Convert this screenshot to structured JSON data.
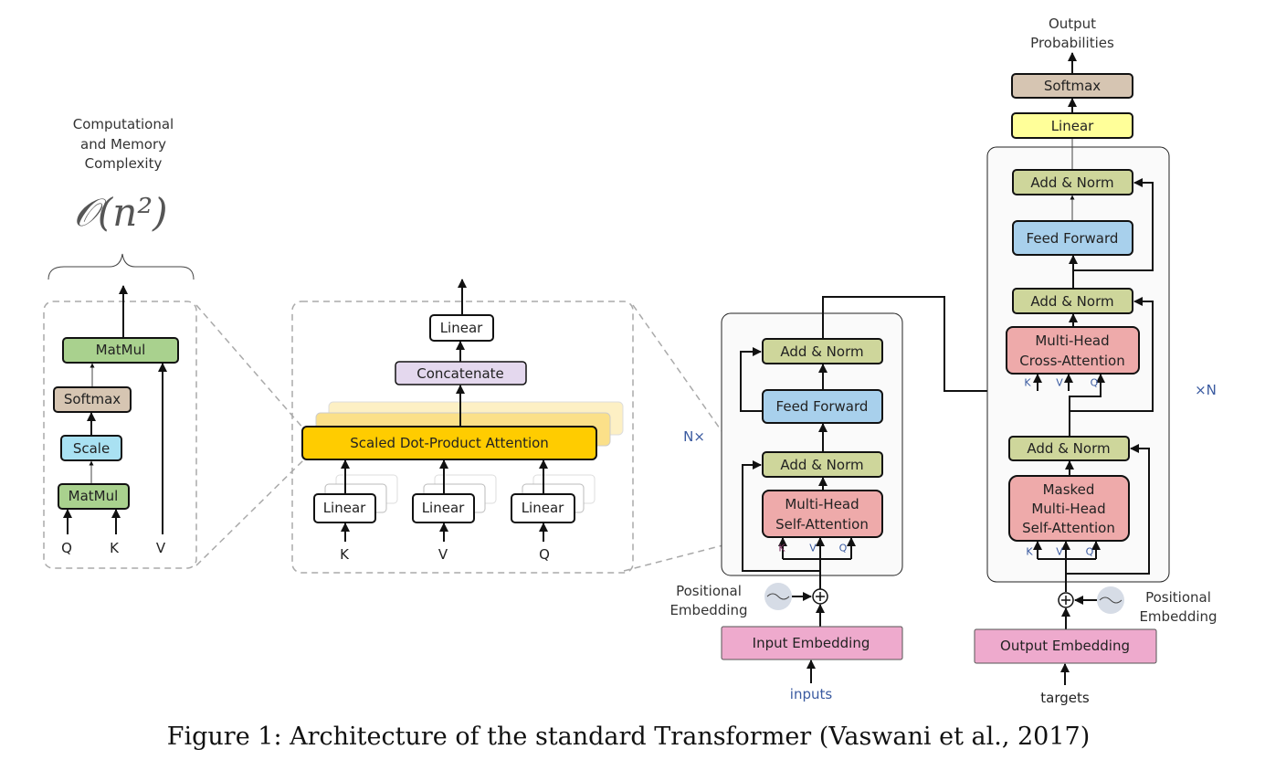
{
  "complexity": {
    "title_lines": [
      "Computational",
      "and Memory",
      "Complexity"
    ],
    "formula": "𝒪(n²)"
  },
  "attention_detail": {
    "matmul_top": "MatMul",
    "softmax": "Softmax",
    "scale": "Scale",
    "matmul_bottom": "MatMul",
    "inputs": [
      "Q",
      "K",
      "V"
    ]
  },
  "multihead_detail": {
    "linear_out": "Linear",
    "concatenate": "Concatenate",
    "sdpa": "Scaled Dot-Product Attention",
    "linears": [
      "Linear",
      "Linear",
      "Linear"
    ],
    "inputs": [
      "K",
      "V",
      "Q"
    ]
  },
  "encoder": {
    "repeat_label": "N×",
    "add_norm_top": "Add & Norm",
    "feed_forward": "Feed Forward",
    "add_norm_bottom": "Add & Norm",
    "attention_lines": [
      "Multi-Head",
      "Self-Attention"
    ],
    "kvq": [
      "K",
      "V",
      "Q"
    ],
    "positional_lines": [
      "Positional",
      "Embedding"
    ],
    "embedding": "Input Embedding",
    "input_label": "inputs"
  },
  "decoder": {
    "output_lines": [
      "Output",
      "Probabilities"
    ],
    "softmax": "Softmax",
    "linear": "Linear",
    "add_norm_top": "Add & Norm",
    "feed_forward": "Feed Forward",
    "add_norm_mid": "Add & Norm",
    "cross_attention_lines": [
      "Multi-Head",
      "Cross-Attention"
    ],
    "cross_kvq": [
      "K",
      "V",
      "Q"
    ],
    "add_norm_bottom": "Add & Norm",
    "masked_attention_lines": [
      "Masked",
      "Multi-Head",
      "Self-Attention"
    ],
    "masked_kvq": [
      "K",
      "V",
      "Q"
    ],
    "repeat_label": "×N",
    "positional_lines": [
      "Positional",
      "Embedding"
    ],
    "embedding": "Output Embedding",
    "input_label": "targets"
  },
  "caption": "Figure 1: Architecture of the standard Transformer (Vaswani et al., 2017)",
  "colors": {
    "matmul": "#a9d18e",
    "softmax": "#d6c5b2",
    "scale": "#a9e1f2",
    "linear_out": "#ffff99",
    "concatenate": "#e4d8ee",
    "sdpa": "#ffcc00",
    "add_norm": "#ced69b",
    "feed_forward": "#a8d0ec",
    "attention": "#eeaaaa",
    "embedding": "#eeaacd"
  }
}
